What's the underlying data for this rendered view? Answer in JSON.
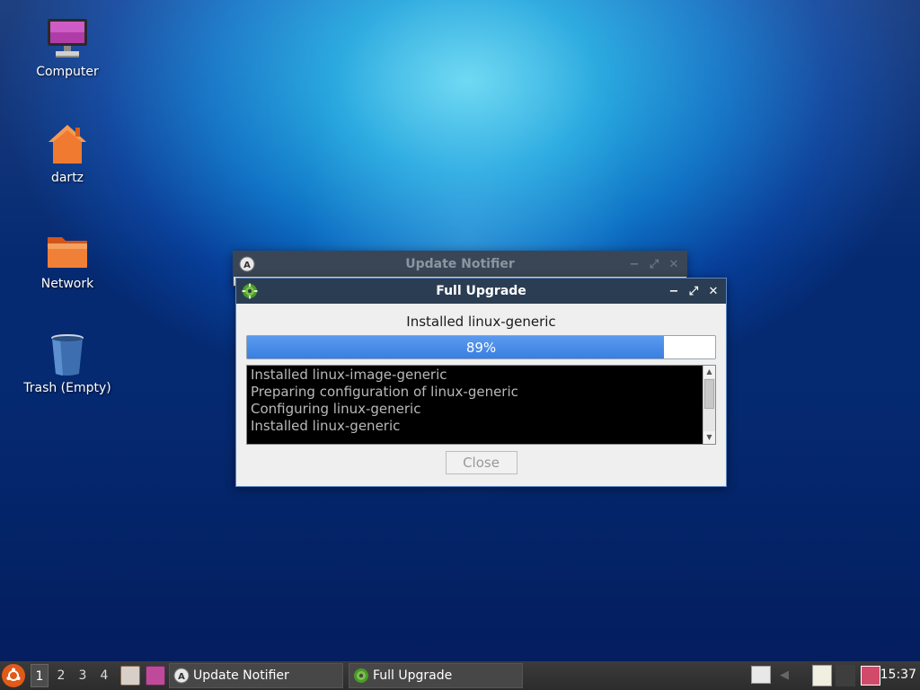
{
  "desktop": {
    "icons": [
      {
        "label": "Computer",
        "icon": "computer-icon"
      },
      {
        "label": "dartz",
        "icon": "home-folder-icon"
      },
      {
        "label": "Network",
        "icon": "folder-icon"
      },
      {
        "label": "Trash (Empty)",
        "icon": "trash-icon"
      }
    ]
  },
  "update_notifier": {
    "title": "Update Notifier"
  },
  "full_upgrade": {
    "title": "Full Upgrade",
    "status": "Installed linux-generic",
    "progress_percent": 89,
    "progress_label": "89%",
    "log_lines": [
      "Installed linux-image-generic",
      "Preparing configuration of linux-generic",
      "Configuring linux-generic",
      "Installed linux-generic"
    ],
    "close_label": "Close",
    "controls": {
      "minimize": "−",
      "maximize": "⤢",
      "close": "✕"
    }
  },
  "taskbar": {
    "workspaces": [
      "1",
      "2",
      "3",
      "4"
    ],
    "active_workspace": "1",
    "tasks": [
      {
        "label": "Update Notifier"
      },
      {
        "label": "Full Upgrade"
      }
    ],
    "clock": "15:37"
  },
  "colors": {
    "progress_fill": "#3a7fe0",
    "titlebar": "#2b3d52",
    "menu_button": "#e05a1a"
  }
}
